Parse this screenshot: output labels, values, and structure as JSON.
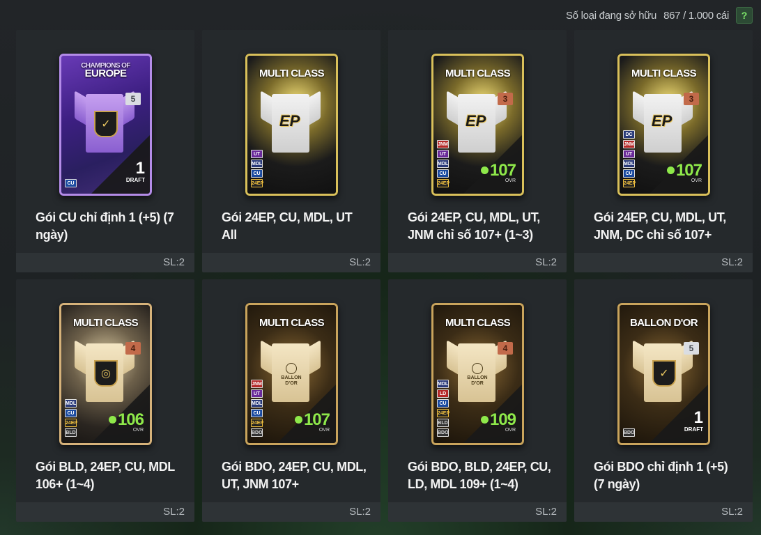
{
  "header": {
    "owned_label": "Số loại đang sở hữu",
    "owned_count": "867 / 1.000 cái",
    "help_label": "?"
  },
  "packs": [
    {
      "name": "Gói CU chỉ định 1 (+5) (7 ngày)",
      "qty": "SL:2",
      "card": {
        "style": "purple",
        "title_small": "CHAMPIONS OF",
        "title": "EUROPE",
        "level": "5",
        "level_color": "silver",
        "positions": [
          "CU"
        ],
        "draft_num": "1",
        "draft_label": "DRAFT",
        "shirt": "purple",
        "emblem": "check"
      }
    },
    {
      "name": "Gói 24EP, CU, MDL, UT All",
      "qty": "SL:2",
      "card": {
        "style": "ep",
        "title": "MULTI CLASS",
        "positions": [
          "UT",
          "MDL",
          "CU",
          "24EP"
        ],
        "shirt": "white",
        "emblem": "EP"
      }
    },
    {
      "name": "Gói 24EP, CU, MDL, UT, JNM chỉ số 107+ (1~3)",
      "qty": "SL:2",
      "card": {
        "style": "ep",
        "title": "MULTI CLASS",
        "level": "3",
        "level_color": "copper",
        "positions": [
          "JNM",
          "UT",
          "MDL",
          "CU",
          "24EP"
        ],
        "ovr": "107",
        "ovr_label": "OVR",
        "shirt": "white",
        "emblem": "EP"
      }
    },
    {
      "name": "Gói 24EP, CU, MDL, UT, JNM, DC chỉ số 107+",
      "qty": "SL:2",
      "card": {
        "style": "ep",
        "title": "MULTI CLASS",
        "level": "3",
        "level_color": "copper",
        "positions": [
          "DC",
          "JNM",
          "UT",
          "MDL",
          "CU",
          "24EP"
        ],
        "ovr": "107",
        "ovr_label": "OVR",
        "shirt": "white",
        "emblem": "EP"
      }
    },
    {
      "name": "Gói BLD, 24EP, CU, MDL 106+ (1~4)",
      "qty": "SL:2",
      "card": {
        "style": "bld",
        "title": "MULTI CLASS",
        "level": "4",
        "level_color": "copper",
        "positions": [
          "MDL",
          "CU",
          "24EP",
          "BLD"
        ],
        "ovr": "106",
        "ovr_label": "OVR",
        "shirt": "cream",
        "emblem": "ball"
      }
    },
    {
      "name": "Gói BDO, 24EP, CU, MDL, UT, JNM 107+",
      "qty": "SL:2",
      "card": {
        "style": "bdo",
        "title": "MULTI CLASS",
        "positions": [
          "JNM",
          "UT",
          "MDL",
          "CU",
          "24EP",
          "BDO"
        ],
        "ovr": "107",
        "ovr_label": "OVR",
        "shirt": "cream",
        "emblem": "bdo"
      }
    },
    {
      "name": "Gói BDO, BLD, 24EP, CU, LD, MDL 109+ (1~4)",
      "qty": "SL:2",
      "card": {
        "style": "bdo",
        "title": "MULTI CLASS",
        "level": "4",
        "level_color": "copper",
        "positions": [
          "MDL",
          "LD",
          "CU",
          "24EP",
          "BLD",
          "BDO"
        ],
        "ovr": "109",
        "ovr_label": "OVR",
        "shirt": "cream",
        "emblem": "bdo"
      }
    },
    {
      "name": "Gói BDO chỉ định 1 (+5) (7 ngày)",
      "qty": "SL:2",
      "card": {
        "style": "bdo",
        "title": "BALLON D'OR",
        "level": "5",
        "level_color": "silver",
        "positions": [
          "BDO"
        ],
        "draft_num": "1",
        "draft_label": "DRAFT",
        "shirt": "cream",
        "emblem": "check"
      }
    }
  ]
}
